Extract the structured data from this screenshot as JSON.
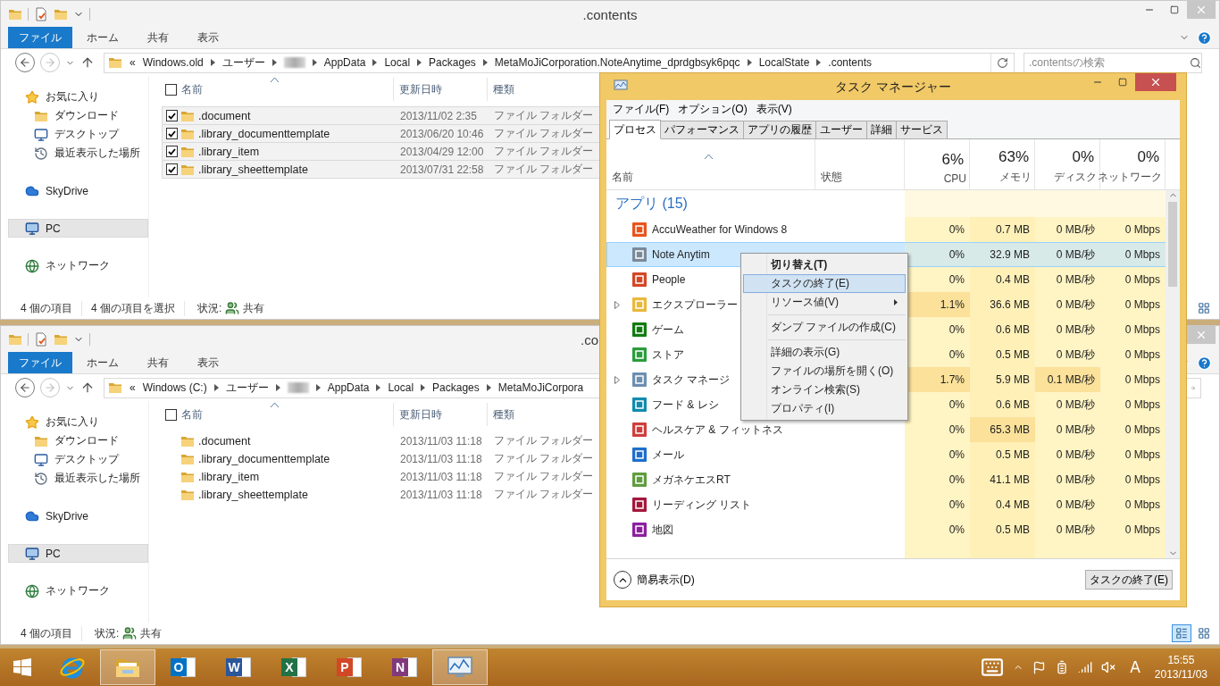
{
  "explorers": [
    {
      "title": ".contents",
      "ribbon_tabs": [
        {
          "label": "ファイル",
          "selected": true
        },
        {
          "label": "ホーム",
          "selected": false
        },
        {
          "label": "共有",
          "selected": false
        },
        {
          "label": "表示",
          "selected": false
        }
      ],
      "address": {
        "overflow": "«",
        "crumbs": [
          {
            "kind": "text",
            "label": "Windows.old"
          },
          {
            "kind": "text",
            "label": "ユーザー"
          },
          {
            "kind": "blurred"
          },
          {
            "kind": "text",
            "label": "AppData"
          },
          {
            "kind": "text",
            "label": "Local"
          },
          {
            "kind": "text",
            "label": "Packages"
          },
          {
            "kind": "text",
            "label": "MetaMoJiCorporation.NoteAnytime_dprdgbsyk6pqc"
          },
          {
            "kind": "text",
            "label": "LocalState"
          },
          {
            "kind": "text",
            "label": ".contents"
          }
        ]
      },
      "search": {
        "placeholder": ".contentsの検索"
      },
      "select_all": {
        "checked": false
      },
      "nav": [
        {
          "kind": "favorites",
          "label": "お気に入り",
          "selected": false,
          "children": [
            {
              "kind": "download",
              "label": "ダウンロード",
              "selected": false
            },
            {
              "kind": "desktop",
              "label": "デスクトップ",
              "selected": false
            },
            {
              "kind": "recent",
              "label": "最近表示した場所",
              "selected": false
            }
          ]
        },
        {
          "kind": "skydrive",
          "label": "SkyDrive",
          "selected": false
        },
        {
          "kind": "pc",
          "label": "PC",
          "selected": true
        },
        {
          "kind": "network",
          "label": "ネットワーク",
          "selected": false
        }
      ],
      "columns": [
        "名前",
        "更新日時",
        "種類"
      ],
      "rows": [
        {
          "name": ".document",
          "date": "2013/11/02 2:35",
          "type": "ファイル フォルダー",
          "selected": true
        },
        {
          "name": ".library_documenttemplate",
          "date": "2013/06/20 10:46",
          "type": "ファイル フォルダー",
          "selected": true
        },
        {
          "name": ".library_item",
          "date": "2013/04/29 12:00",
          "type": "ファイル フォルダー",
          "selected": true
        },
        {
          "name": ".library_sheettemplate",
          "date": "2013/07/31 22:58",
          "type": "ファイル フォルダー",
          "selected": true
        }
      ],
      "status": [
        "4 個の項目",
        "4 個の項目を選択"
      ],
      "sharing": {
        "label": "状況:",
        "value": "共有"
      },
      "views": [
        {
          "kind": "tiles",
          "selected": false
        }
      ]
    },
    {
      "title": ".co",
      "ribbon_tabs": [
        {
          "label": "ファイル",
          "selected": true
        },
        {
          "label": "ホーム",
          "selected": false
        },
        {
          "label": "共有",
          "selected": false
        },
        {
          "label": "表示",
          "selected": false
        }
      ],
      "address": {
        "overflow": "«",
        "crumbs": [
          {
            "kind": "text",
            "label": "Windows (C:)"
          },
          {
            "kind": "text",
            "label": "ユーザー"
          },
          {
            "kind": "blurred"
          },
          {
            "kind": "text",
            "label": "AppData"
          },
          {
            "kind": "text",
            "label": "Local"
          },
          {
            "kind": "text",
            "label": "Packages"
          },
          {
            "kind": "text",
            "label": "MetaMoJiCorpora"
          }
        ]
      },
      "select_all": {
        "checked": false
      },
      "nav": [
        {
          "kind": "favorites",
          "label": "お気に入り",
          "selected": false,
          "children": [
            {
              "kind": "download",
              "label": "ダウンロード",
              "selected": false
            },
            {
              "kind": "desktop",
              "label": "デスクトップ",
              "selected": false
            },
            {
              "kind": "recent",
              "label": "最近表示した場所",
              "selected": false
            }
          ]
        },
        {
          "kind": "skydrive",
          "label": "SkyDrive",
          "selected": false
        },
        {
          "kind": "pc",
          "label": "PC",
          "selected": true
        },
        {
          "kind": "network",
          "label": "ネットワーク",
          "selected": false
        }
      ],
      "columns": [
        "名前",
        "更新日時",
        "種類"
      ],
      "rows": [
        {
          "name": ".document",
          "date": "2013/11/03 11:18",
          "type": "ファイル フォルダー",
          "selected": false
        },
        {
          "name": ".library_documenttemplate",
          "date": "2013/11/03 11:18",
          "type": "ファイル フォルダー",
          "selected": false
        },
        {
          "name": ".library_item",
          "date": "2013/11/03 11:18",
          "type": "ファイル フォルダー",
          "selected": false
        },
        {
          "name": ".library_sheettemplate",
          "date": "2013/11/03 11:18",
          "type": "ファイル フォルダー",
          "selected": false
        }
      ],
      "status": [
        "4 個の項目"
      ],
      "sharing": {
        "label": "状況:",
        "value": "共有"
      },
      "views": [
        {
          "kind": "details",
          "selected": true
        },
        {
          "kind": "tiles",
          "selected": false
        }
      ]
    }
  ],
  "task_manager": {
    "title": "タスク マネージャー",
    "menu": [
      "ファイル(F)",
      "オプション(O)",
      "表示(V)"
    ],
    "tabs": [
      {
        "label": "プロセス",
        "selected": true
      },
      {
        "label": "パフォーマンス",
        "selected": false
      },
      {
        "label": "アプリの履歴",
        "selected": false
      },
      {
        "label": "ユーザー",
        "selected": false
      },
      {
        "label": "詳細",
        "selected": false
      },
      {
        "label": "サービス",
        "selected": false
      }
    ],
    "columns": {
      "name": "名前",
      "status": "状態",
      "metrics": [
        {
          "percent": "6%",
          "label": "CPU"
        },
        {
          "percent": "63%",
          "label": "メモリ"
        },
        {
          "percent": "0%",
          "label": "ディスク"
        },
        {
          "percent": "0%",
          "label": "ネットワーク"
        }
      ]
    },
    "group": "アプリ (15)",
    "processes": [
      {
        "name": "AccuWeather for Windows 8",
        "color": "#e8541c",
        "expandable": false,
        "selected": false,
        "values": [
          "0%",
          "0.7 MB",
          "0 MB/秒",
          "0 Mbps"
        ],
        "hot": [
          false,
          false,
          false,
          false
        ]
      },
      {
        "name": "Note Anytim",
        "color": "#7a8a99",
        "expandable": false,
        "selected": true,
        "values": [
          "0%",
          "32.9 MB",
          "0 MB/秒",
          "0 Mbps"
        ],
        "hot": [
          false,
          false,
          false,
          false
        ]
      },
      {
        "name": "People",
        "color": "#d24726",
        "expandable": false,
        "selected": false,
        "values": [
          "0%",
          "0.4 MB",
          "0 MB/秒",
          "0 Mbps"
        ],
        "hot": [
          false,
          false,
          false,
          false
        ]
      },
      {
        "name": "エクスプローラー",
        "color": "#e9b83c",
        "expandable": true,
        "selected": false,
        "values": [
          "1.1%",
          "36.6 MB",
          "0 MB/秒",
          "0 Mbps"
        ],
        "hot": [
          true,
          false,
          false,
          false
        ]
      },
      {
        "name": "ゲーム",
        "color": "#107c10",
        "expandable": false,
        "selected": false,
        "values": [
          "0%",
          "0.6 MB",
          "0 MB/秒",
          "0 Mbps"
        ],
        "hot": [
          false,
          false,
          false,
          false
        ]
      },
      {
        "name": "ストア",
        "color": "#2a9d3c",
        "expandable": false,
        "selected": false,
        "values": [
          "0%",
          "0.5 MB",
          "0 MB/秒",
          "0 Mbps"
        ],
        "hot": [
          false,
          false,
          false,
          false
        ]
      },
      {
        "name": "タスク マネージ",
        "color": "#6d8fb0",
        "expandable": true,
        "selected": false,
        "values": [
          "1.7%",
          "5.9 MB",
          "0.1 MB/秒",
          "0 Mbps"
        ],
        "hot": [
          true,
          false,
          true,
          false
        ]
      },
      {
        "name": "フード & レシ",
        "color": "#0f8bae",
        "expandable": false,
        "selected": false,
        "values": [
          "0%",
          "0.6 MB",
          "0 MB/秒",
          "0 Mbps"
        ],
        "hot": [
          false,
          false,
          false,
          false
        ]
      },
      {
        "name": "ヘルスケア & フィットネス",
        "color": "#d03d3d",
        "expandable": false,
        "selected": false,
        "values": [
          "0%",
          "65.3 MB",
          "0 MB/秒",
          "0 Mbps"
        ],
        "hot": [
          false,
          true,
          false,
          false
        ]
      },
      {
        "name": "メール",
        "color": "#1d6fcb",
        "expandable": false,
        "selected": false,
        "values": [
          "0%",
          "0.5 MB",
          "0 MB/秒",
          "0 Mbps"
        ],
        "hot": [
          false,
          false,
          false,
          false
        ]
      },
      {
        "name": "メガネケエスRT",
        "color": "#5f9d3e",
        "expandable": false,
        "selected": false,
        "values": [
          "0%",
          "41.1 MB",
          "0 MB/秒",
          "0 Mbps"
        ],
        "hot": [
          false,
          false,
          false,
          false
        ]
      },
      {
        "name": "リーディング リスト",
        "color": "#a4173b",
        "expandable": false,
        "selected": false,
        "values": [
          "0%",
          "0.4 MB",
          "0 MB/秒",
          "0 Mbps"
        ],
        "hot": [
          false,
          false,
          false,
          false
        ]
      },
      {
        "name": "地図",
        "color": "#8c1fa0",
        "expandable": false,
        "selected": false,
        "values": [
          "0%",
          "0.5 MB",
          "0 MB/秒",
          "0 Mbps"
        ],
        "hot": [
          false,
          false,
          false,
          false
        ]
      }
    ],
    "context_menu": [
      {
        "kind": "item",
        "label": "切り替え(T)",
        "default": true,
        "selected": false,
        "submenu": false
      },
      {
        "kind": "item",
        "label": "タスクの終了(E)",
        "default": false,
        "selected": true,
        "submenu": false
      },
      {
        "kind": "item",
        "label": "リソース値(V)",
        "default": false,
        "selected": false,
        "submenu": true
      },
      {
        "kind": "separator"
      },
      {
        "kind": "item",
        "label": "ダンプ ファイルの作成(C)",
        "default": false,
        "selected": false,
        "submenu": false
      },
      {
        "kind": "separator"
      },
      {
        "kind": "item",
        "label": "詳細の表示(G)",
        "default": false,
        "selected": false,
        "submenu": false
      },
      {
        "kind": "item",
        "label": "ファイルの場所を開く(O)",
        "default": false,
        "selected": false,
        "submenu": false
      },
      {
        "kind": "item",
        "label": "オンライン検索(S)",
        "default": false,
        "selected": false,
        "submenu": false
      },
      {
        "kind": "item",
        "label": "プロパティ(I)",
        "default": false,
        "selected": false,
        "submenu": false
      }
    ],
    "footer": {
      "toggle": "簡易表示(D)",
      "button": "タスクの終了(E)"
    }
  },
  "taskbar": {
    "apps": [
      {
        "kind": "start",
        "selected": false
      },
      {
        "kind": "ie",
        "selected": false
      },
      {
        "kind": "folder",
        "selected": true
      },
      {
        "kind": "tile",
        "letter": "O",
        "color": "#0072c6",
        "selected": false
      },
      {
        "kind": "tile",
        "letter": "W",
        "color": "#2b579a",
        "selected": false
      },
      {
        "kind": "tile",
        "letter": "X",
        "color": "#217346",
        "selected": false
      },
      {
        "kind": "tile",
        "letter": "P",
        "color": "#d24726",
        "selected": false
      },
      {
        "kind": "tile",
        "letter": "N",
        "color": "#80397b",
        "selected": false
      },
      {
        "kind": "monitor",
        "selected": true
      }
    ],
    "ime": "A",
    "time": "15:55",
    "date": "2013/11/03"
  }
}
